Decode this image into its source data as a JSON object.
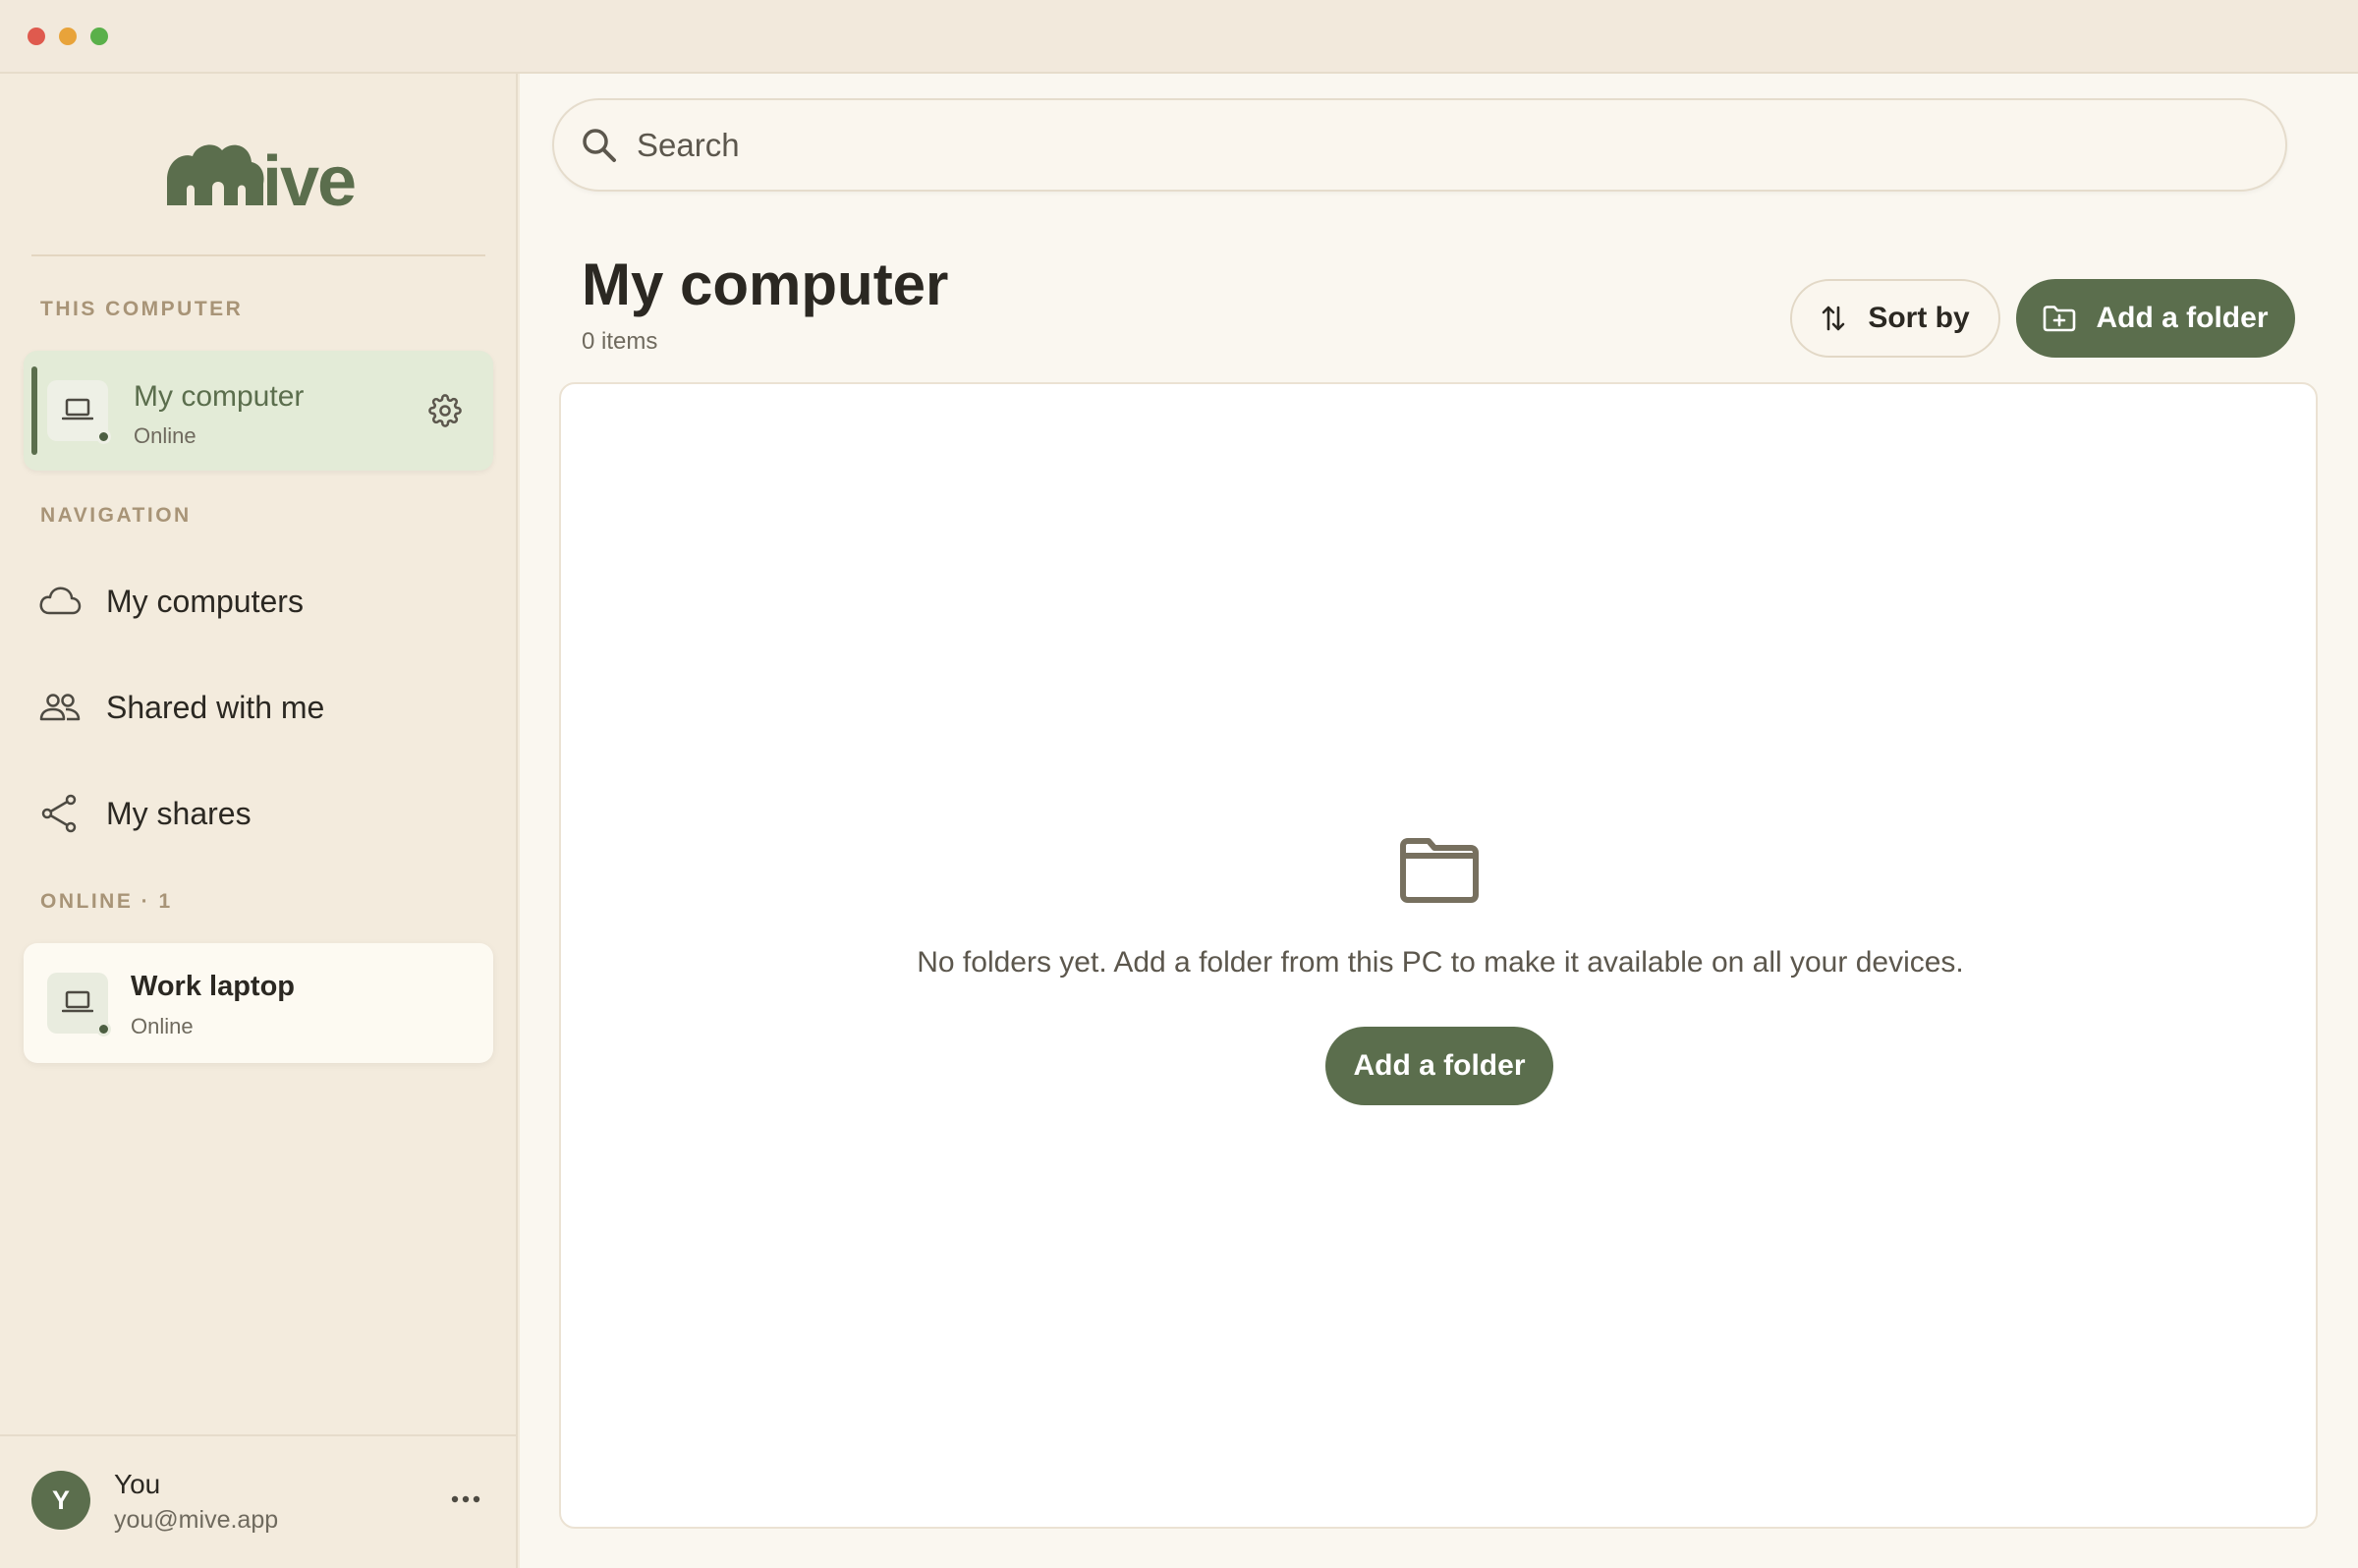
{
  "app": {
    "logo_text": "mive",
    "colors": {
      "accent": "#5b6e4d",
      "background": "#f3ebdd",
      "active_card": "#e3ebd7"
    }
  },
  "sidebar": {
    "this_computer_label": "THIS COMPUTER",
    "current_device": {
      "name": "My computer",
      "status": "Online",
      "icon": "laptop-icon"
    },
    "navigation_label": "NAVIGATION",
    "nav_items": [
      {
        "label": "My computers",
        "icon": "cloud-icon"
      },
      {
        "label": "Shared with me",
        "icon": "users-icon"
      },
      {
        "label": "My shares",
        "icon": "share-icon"
      }
    ],
    "online_label": "ONLINE · 1",
    "online_devices": [
      {
        "name": "Work laptop",
        "status": "Online",
        "icon": "laptop-icon"
      }
    ]
  },
  "user": {
    "initial": "Y",
    "name": "You",
    "email": "you@mive.app"
  },
  "search": {
    "placeholder": "Search",
    "value": ""
  },
  "main": {
    "title": "My computer",
    "item_count": "0 items",
    "sort_label": "Sort by",
    "add_folder_label": "Add a folder",
    "empty_message": "No folders yet. Add a folder from this PC to make it available on all your devices.",
    "empty_add_folder_label": "Add a folder"
  }
}
